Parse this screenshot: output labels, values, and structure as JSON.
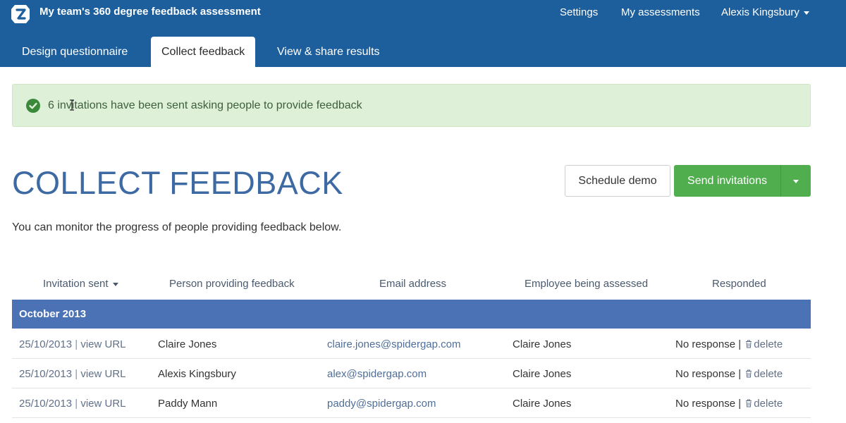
{
  "app": {
    "title": "My team's 360 degree feedback assessment"
  },
  "topnav": {
    "settings": "Settings",
    "assessments": "My assessments",
    "user": "Alexis Kingsbury"
  },
  "tabs": [
    {
      "label": "Design questionnaire"
    },
    {
      "label": "Collect feedback"
    },
    {
      "label": "View & share results"
    }
  ],
  "alert": {
    "text": "6 invitations have been sent asking people to provide feedback"
  },
  "page": {
    "title": "COLLECT FEEDBACK",
    "subtitle": "You can monitor the progress of people providing feedback below.",
    "schedule_demo": "Schedule demo",
    "send_invitations": "Send invitations"
  },
  "table": {
    "headers": {
      "sent": "Invitation sent",
      "person": "Person providing feedback",
      "email": "Email address",
      "employee": "Employee being assessed",
      "responded": "Responded"
    },
    "group": "October 2013",
    "rows": [
      {
        "date": "25/10/2013",
        "view": "view URL",
        "person": "Claire Jones",
        "email": "claire.jones@spidergap.com",
        "employee": "Claire Jones",
        "response": "No response",
        "delete": "delete"
      },
      {
        "date": "25/10/2013",
        "view": "view URL",
        "person": "Alexis Kingsbury",
        "email": "alex@spidergap.com",
        "employee": "Claire Jones",
        "response": "No response",
        "delete": "delete"
      },
      {
        "date": "25/10/2013",
        "view": "view URL",
        "person": "Paddy Mann",
        "email": "paddy@spidergap.com",
        "employee": "Claire Jones",
        "response": "No response",
        "delete": "delete"
      }
    ]
  },
  "colors": {
    "header_bg": "#1d5f9c",
    "alert_bg": "#dff0d8",
    "heading": "#3e6aa3",
    "send_button": "#50ae4f",
    "group_row": "#4b72b5"
  },
  "icons": {
    "logo": "spidergap-logo-icon",
    "alert": "check-circle-icon",
    "delete": "trash-icon",
    "dropdown": "caret-down-icon"
  }
}
